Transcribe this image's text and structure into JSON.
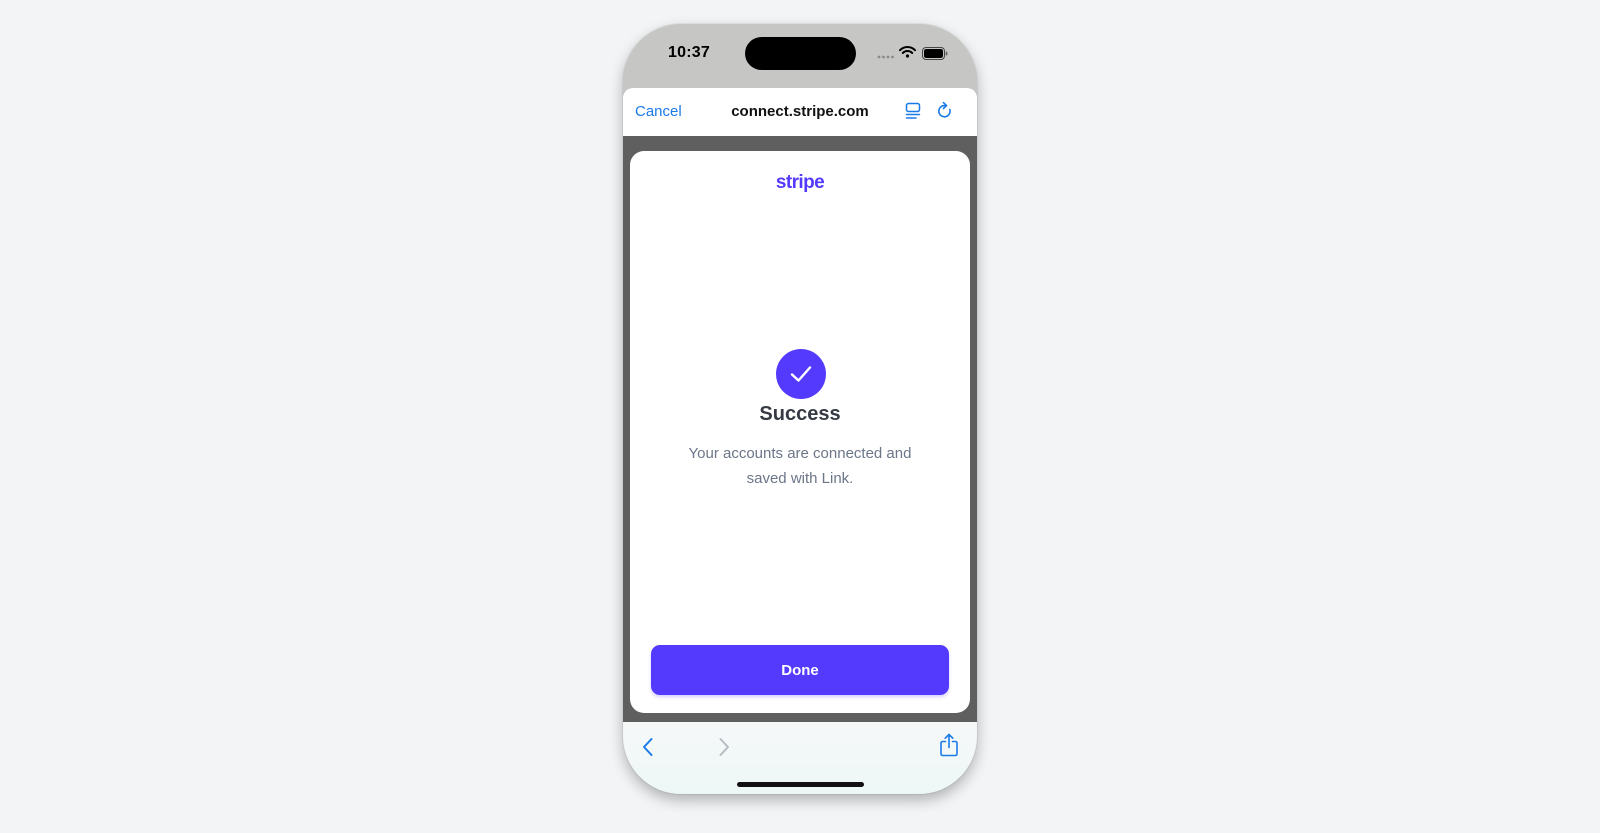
{
  "status_bar": {
    "time": "10:37",
    "icons": [
      "signal-icon",
      "wifi-icon",
      "battery-icon"
    ]
  },
  "browser": {
    "cancel_label": "Cancel",
    "url": "connect.stripe.com",
    "icons": [
      "reader-view-icon",
      "reload-icon"
    ]
  },
  "page": {
    "logo_text": "stripe",
    "title": "Success",
    "message": "Your accounts are connected and saved with Link.",
    "done_label": "Done",
    "icon": "checkmark-icon"
  },
  "toolbar": {
    "icons": [
      "chevron-left-icon",
      "chevron-right-icon",
      "share-icon"
    ]
  },
  "colors": {
    "accent": "#533afd",
    "link_blue": "#1a7ae8",
    "title": "#353a44",
    "body_text": "#6c7688",
    "backdrop": "#5f5f5f"
  }
}
